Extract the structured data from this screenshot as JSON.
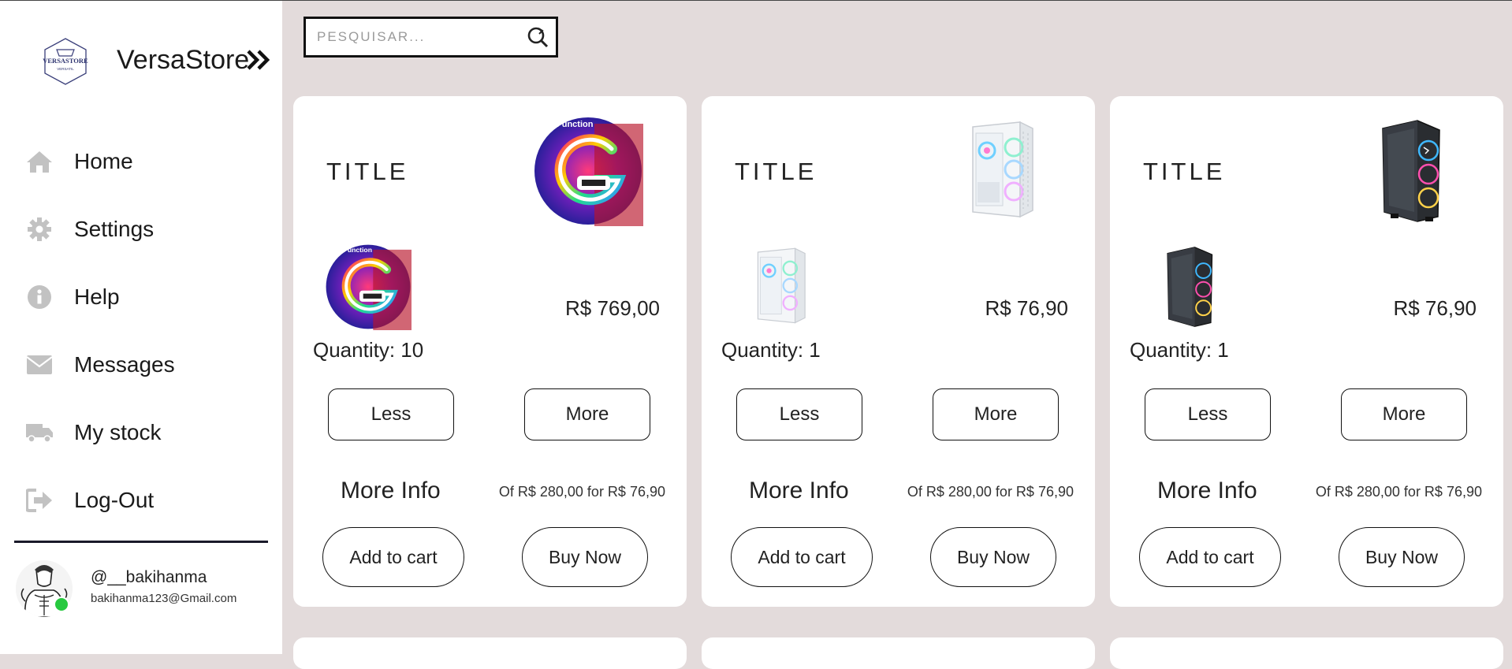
{
  "app": {
    "brand_name": "VersaStore",
    "logo_text_top": "VERSASTORE",
    "logo_text_bottom": "VERSATIL",
    "logo_icon": "versastore-logo"
  },
  "search": {
    "placeholder": "PESQUISAR...",
    "value": "",
    "icon": "search-icon"
  },
  "sidebar": {
    "items": [
      {
        "label": "Home",
        "icon": "home-icon"
      },
      {
        "label": "Settings",
        "icon": "gear-icon"
      },
      {
        "label": "Help",
        "icon": "info-icon"
      },
      {
        "label": "Messages",
        "icon": "envelope-icon"
      },
      {
        "label": "My stock",
        "icon": "truck-icon"
      },
      {
        "label": "Log-Out",
        "icon": "logout-icon"
      }
    ],
    "expand_icon": "double-chevron-right-icon"
  },
  "user": {
    "username": "@__bakihanma",
    "email": "bakihanma123@Gmail.com",
    "status": "online",
    "status_color": "#27c93f"
  },
  "products": [
    {
      "title": "TITLE",
      "price": "R$ 769,00",
      "quantity": "Quantity: 10",
      "less_label": "Less",
      "more_label": "More",
      "more_info_label": "More Info",
      "offer": "Of R$ 280,00 for R$ 76,90",
      "add_to_cart_label": "Add to cart",
      "buy_now_label": "Buy Now",
      "image_kind": "wireless-charger-speaker",
      "image_text": "Function"
    },
    {
      "title": "TITLE",
      "price": "R$ 76,90",
      "quantity": "Quantity: 1",
      "less_label": "Less",
      "more_label": "More",
      "more_info_label": "More Info",
      "offer": "Of R$ 280,00 for R$ 76,90",
      "add_to_cart_label": "Add to cart",
      "buy_now_label": "Buy Now",
      "image_kind": "white-pc-case"
    },
    {
      "title": "TITLE",
      "price": "R$ 76,90",
      "quantity": "Quantity: 1",
      "less_label": "Less",
      "more_label": "More",
      "more_info_label": "More Info",
      "offer": "Of R$ 280,00 for R$ 76,90",
      "add_to_cart_label": "Add to cart",
      "buy_now_label": "Buy Now",
      "image_kind": "black-pc-case"
    }
  ],
  "colors": {
    "page_background": "#e3dbdb",
    "card_background": "#ffffff",
    "sidebar_background": "#ffffff",
    "icon_gray": "#c2c2c2",
    "border": "#111111"
  }
}
